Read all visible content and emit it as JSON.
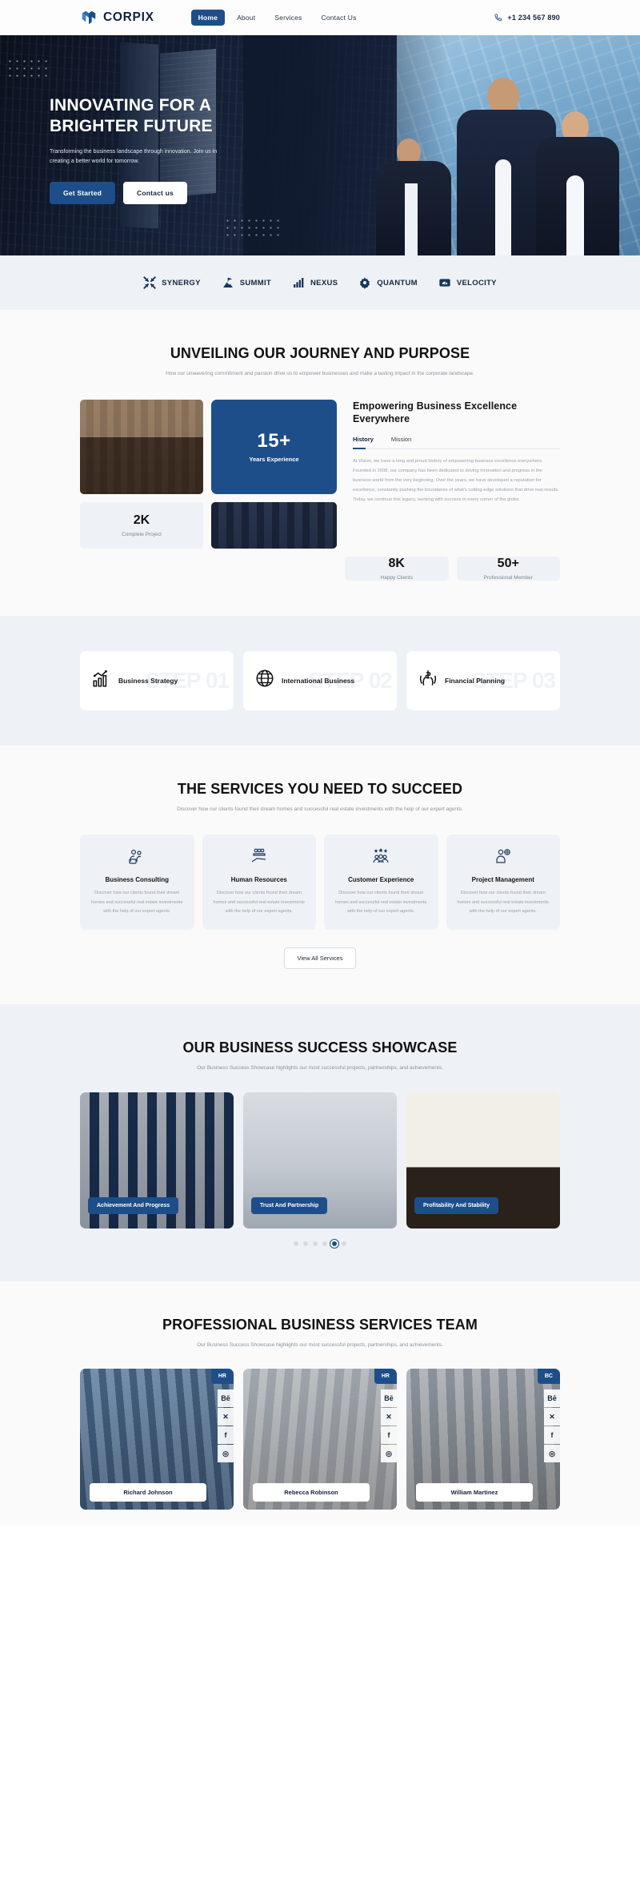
{
  "header": {
    "brand": "CORPIX",
    "logo_icon": "corpix-logo-icon",
    "nav": [
      {
        "label": "Home",
        "active": true
      },
      {
        "label": "About",
        "active": false
      },
      {
        "label": "Services",
        "active": false
      },
      {
        "label": "Contact Us",
        "active": false
      }
    ],
    "phone_icon": "phone-icon",
    "phone": "+1 234 567 890"
  },
  "hero": {
    "title_line1": "INNOVATING FOR A",
    "title_line2": "BRIGHTER FUTURE",
    "subtitle": "Transforming the business landscape through innovation. Join us in creating a better world for tomorrow.",
    "primary_button": "Get Started",
    "secondary_button": "Contact us"
  },
  "brands": [
    {
      "name": "SYNERGY",
      "icon": "arrows-converge-icon"
    },
    {
      "name": "SUMMIT",
      "icon": "mountain-flag-icon"
    },
    {
      "name": "NEXUS",
      "icon": "bar-chart-growth-icon"
    },
    {
      "name": "QUANTUM",
      "icon": "gear-cog-icon"
    },
    {
      "name": "VELOCITY",
      "icon": "speed-meter-icon"
    }
  ],
  "about": {
    "title": "UNVEILING OUR JOURNEY AND PURPOSE",
    "subtitle": "How our unwavering commitment and passion drive us to empower businesses and make a lasting impact in the corporate landscape.",
    "years_number": "15+",
    "years_label": "Years Experience",
    "heading": "Empowering Business Excellence Everywhere",
    "tabs": [
      {
        "label": "History",
        "active": true
      },
      {
        "label": "Mission",
        "active": false
      }
    ],
    "paragraph": "At Vision, we have a long and proud history of empowering business excellence everywhere. Founded in 2008, our company has been dedicated to driving innovation and progress in the business world from the very beginning. Over the years, we have developed a reputation for excellence, constantly pushing the boundaries of what's cutting-edge solutions that drive real results. Today, we continue this legacy, working with success in every corner of the globe.",
    "stats": [
      {
        "number": "2K",
        "label": "Complete Project"
      },
      {
        "number": "8K",
        "label": "Happy Clients"
      },
      {
        "number": "50+",
        "label": "Professional Member"
      }
    ]
  },
  "steps": [
    {
      "label": "Business Strategy",
      "ghost": "STEP 01",
      "icon": "bar-chart-line-icon"
    },
    {
      "label": "International Business",
      "ghost": "STEP 02",
      "icon": "globe-icon"
    },
    {
      "label": "Financial Planning",
      "ghost": "STEP 03",
      "icon": "hands-dollar-icon"
    }
  ],
  "services": {
    "title": "THE SERVICES YOU NEED TO SUCCEED",
    "subtitle": "Discover how our clients found their dream homes and successful real estate investments with the help of our expert agents.",
    "cards": [
      {
        "title": "Business Consulting",
        "desc": "Discover how our clients found their dream homes and successful real estate investments with the help of our expert agents.",
        "icon": "consulting-people-icon"
      },
      {
        "title": "Human Resources",
        "desc": "Discover how our clients found their dream homes and successful real estate investments with the help of our expert agents.",
        "icon": "hand-people-icon"
      },
      {
        "title": "Customer Experience",
        "desc": "Discover how our clients found their dream homes and successful real estate investments with the help of our expert agents.",
        "icon": "stars-group-icon"
      },
      {
        "title": "Project Management",
        "desc": "Discover how our clients found their dream homes and successful real estate investments with the help of our expert agents.",
        "icon": "person-gear-icon"
      }
    ],
    "view_all_button": "View All Services"
  },
  "showcase": {
    "title": "OUR BUSINESS SUCCESS SHOWCASE",
    "subtitle": "Our Business Success Showcase highlights our most successful projects, partnerships, and achievements.",
    "cards": [
      {
        "tag": "Achievement And Progress"
      },
      {
        "tag": "Trust And Partnership"
      },
      {
        "tag": "Profitability And Stability"
      }
    ],
    "pagination": {
      "count": 6,
      "active_index": 4
    }
  },
  "team": {
    "title": "PROFESSIONAL BUSINESS SERVICES TEAM",
    "subtitle": "Our Business Success Showcase highlights our most successful projects, partnerships, and achievements.",
    "members": [
      {
        "name": "Richard Johnson",
        "badge": "HR",
        "socials": [
          "Bē",
          "✕",
          "f",
          "◎"
        ]
      },
      {
        "name": "Rebecca Robinson",
        "badge": "HR",
        "socials": [
          "Bē",
          "✕",
          "f",
          "◎"
        ]
      },
      {
        "name": "William Martinez",
        "badge": "BC",
        "socials": [
          "Bē",
          "✕",
          "f",
          "◎"
        ]
      }
    ]
  },
  "colors": {
    "accent": "#1d4e89",
    "dark": "#0d1526",
    "grey_bg": "#eef2f6"
  }
}
